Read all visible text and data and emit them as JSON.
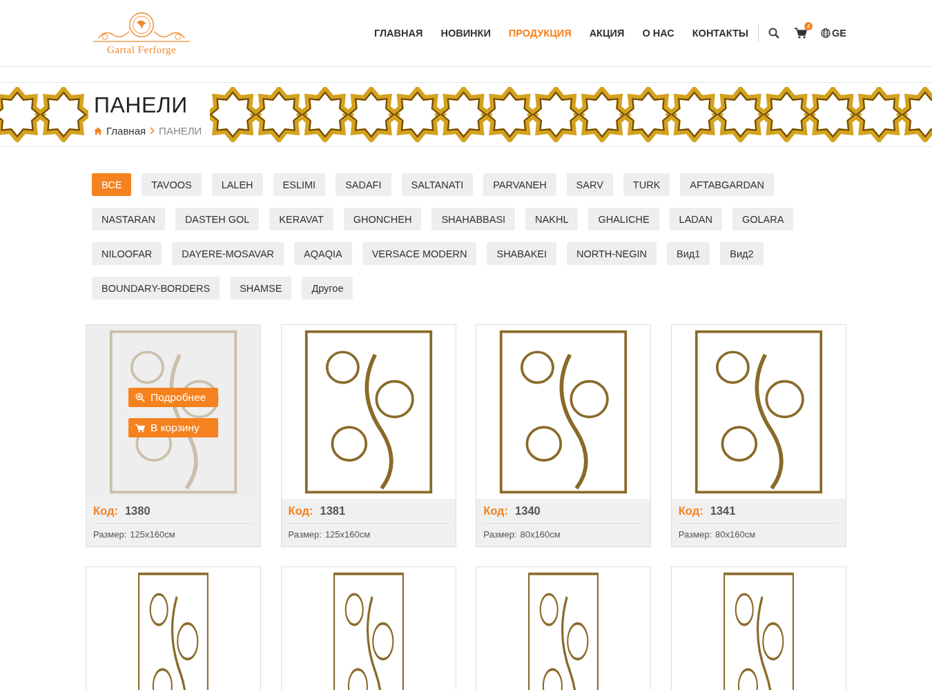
{
  "logo": {
    "text": "Gartal Ferforge"
  },
  "nav": [
    {
      "label": "ГЛАВНАЯ",
      "selected": false
    },
    {
      "label": "НОВИНКИ",
      "selected": false
    },
    {
      "label": "ПРОДУКЦИЯ",
      "selected": true
    },
    {
      "label": "АКЦИЯ",
      "selected": false
    },
    {
      "label": "О НАС",
      "selected": false
    },
    {
      "label": "КОНТАКТЫ",
      "selected": false
    }
  ],
  "cart": {
    "count": "4"
  },
  "language": "GE",
  "page_title": "ПАНЕЛИ",
  "breadcrumb": [
    "Главная",
    "ПАНЕЛИ"
  ],
  "filters": [
    {
      "label": "ВСЕ",
      "selected": true
    },
    {
      "label": "TAVOOS",
      "selected": false
    },
    {
      "label": "LALEH",
      "selected": false
    },
    {
      "label": "ESLIMI",
      "selected": false
    },
    {
      "label": "SADAFI",
      "selected": false
    },
    {
      "label": "SALTANATI",
      "selected": false
    },
    {
      "label": "PARVANEH",
      "selected": false
    },
    {
      "label": "SARV",
      "selected": false
    },
    {
      "label": "TURK",
      "selected": false
    },
    {
      "label": "AFTABGARDAN",
      "selected": false
    },
    {
      "label": "NASTARAN",
      "selected": false
    },
    {
      "label": "DASTEH GOL",
      "selected": false
    },
    {
      "label": "KERAVAT",
      "selected": false
    },
    {
      "label": "GHONCHEH",
      "selected": false
    },
    {
      "label": "SHAHABBASI",
      "selected": false
    },
    {
      "label": "NAKHL",
      "selected": false
    },
    {
      "label": "GHALICHE",
      "selected": false
    },
    {
      "label": "LADAN",
      "selected": false
    },
    {
      "label": "GOLARA",
      "selected": false
    },
    {
      "label": "NILOOFAR",
      "selected": false
    },
    {
      "label": "DAYERE-MOSAVAR",
      "selected": false
    },
    {
      "label": "AQAQIA",
      "selected": false
    },
    {
      "label": "VERSACE MODERN",
      "selected": false
    },
    {
      "label": "SHABAKEI",
      "selected": false
    },
    {
      "label": "NORTH-NEGIN",
      "selected": false
    },
    {
      "label": "Вид1",
      "selected": false
    },
    {
      "label": "Вид2",
      "selected": false
    },
    {
      "label": "BOUNDARY-BORDERS",
      "selected": false
    },
    {
      "label": "SHAMSE",
      "selected": false
    },
    {
      "label": "Другое",
      "selected": false
    }
  ],
  "product_actions": [
    "Подробнее",
    "В корзину"
  ],
  "products": [
    {
      "code_label": "Код:",
      "code": "1380",
      "size_label": "Размер:",
      "size": "125x160см",
      "hovered": true
    },
    {
      "code_label": "Код:",
      "code": "1381",
      "size_label": "Размер:",
      "size": "125x160см",
      "hovered": false
    },
    {
      "code_label": "Код:",
      "code": "1340",
      "size_label": "Размер:",
      "size": "80x160см",
      "hovered": false
    },
    {
      "code_label": "Код:",
      "code": "1341",
      "size_label": "Размер:",
      "size": "80x160см",
      "hovered": false
    },
    {
      "hovered": false
    },
    {
      "hovered": false
    },
    {
      "hovered": false
    },
    {
      "hovered": false
    }
  ]
}
